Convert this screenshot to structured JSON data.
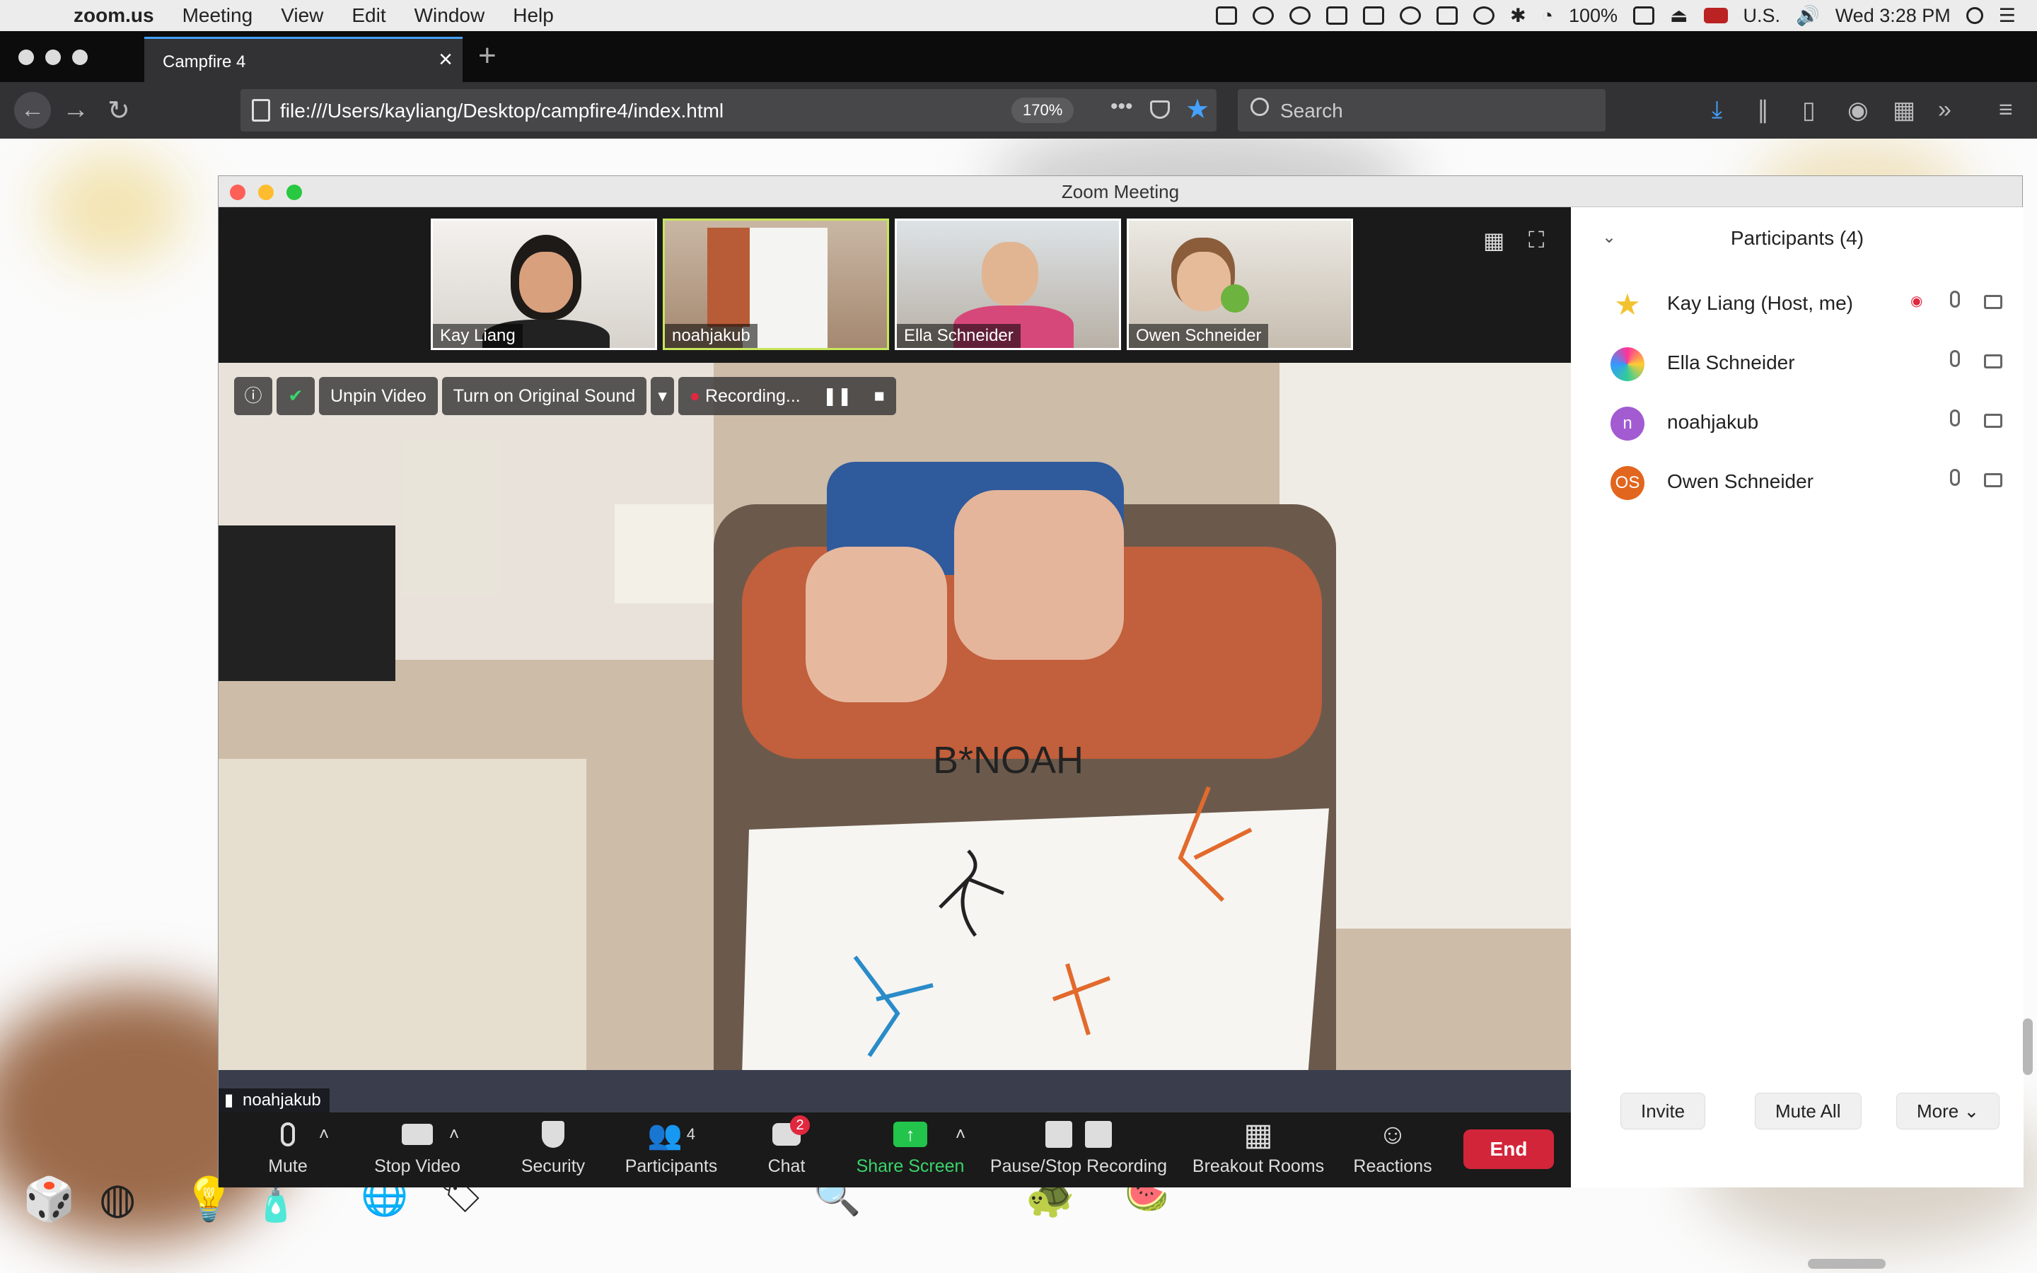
{
  "menubar": {
    "app_name": "zoom.us",
    "items": [
      "Meeting",
      "View",
      "Edit",
      "Window",
      "Help"
    ],
    "battery": "100%",
    "input_source": "U.S.",
    "clock": "Wed 3:28 PM"
  },
  "browser": {
    "tab_title": "Campfire 4",
    "url": "file:///Users/kayliang/Desktop/campfire4/index.html",
    "zoom": "170%",
    "search_placeholder": "Search"
  },
  "zoom": {
    "window_title": "Zoom Meeting",
    "thumbnails": [
      {
        "name": "Kay Liang",
        "active": false
      },
      {
        "name": "noahjakub",
        "active": true
      },
      {
        "name": "Ella Schneider",
        "active": false
      },
      {
        "name": "Owen Schneider",
        "active": false
      }
    ],
    "video_controls": {
      "unpin": "Unpin Video",
      "original_sound": "Turn on Original Sound",
      "recording": "Recording..."
    },
    "main_video_name": "noahjakub",
    "drawing_text": "B*NOAH",
    "toolbar": {
      "mute": "Mute",
      "stop_video": "Stop Video",
      "security": "Security",
      "participants": "Participants",
      "participants_count": "4",
      "chat": "Chat",
      "chat_badge": "2",
      "share_screen": "Share Screen",
      "pause_stop_recording": "Pause/Stop Recording",
      "breakout_rooms": "Breakout Rooms",
      "reactions": "Reactions",
      "end": "End"
    },
    "panel": {
      "title": "Participants (4)",
      "participants": [
        {
          "name": "Kay Liang (Host, me)",
          "avatar": "star-avatar-icon",
          "avatar_text": ""
        },
        {
          "name": "Ella Schneider",
          "avatar": "colorful-avatar-icon",
          "avatar_text": ""
        },
        {
          "name": "noahjakub",
          "avatar": "letter-avatar",
          "avatar_text": "n"
        },
        {
          "name": "Owen Schneider",
          "avatar": "letter-avatar",
          "avatar_text": "OS"
        }
      ],
      "buttons": {
        "invite": "Invite",
        "mute_all": "Mute All",
        "more": "More"
      }
    },
    "colors": {
      "end": "#d3253a",
      "share": "#23c44b",
      "active_thumb": "#c7e65c",
      "chat_badge": "#e0283e"
    }
  }
}
